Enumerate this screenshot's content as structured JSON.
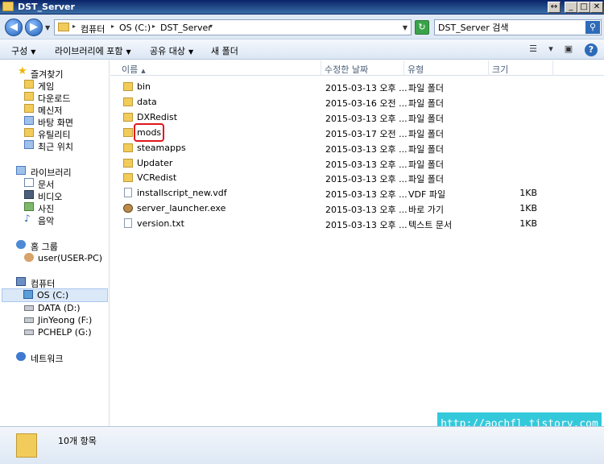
{
  "window": {
    "title": "DST_Server"
  },
  "title_buttons": [
    "↔",
    "_",
    "□",
    "✕"
  ],
  "address": {
    "crumbs": [
      "컴퓨터",
      "OS (C:)",
      "DST_Server"
    ]
  },
  "search": {
    "value": "DST_Server 검색"
  },
  "toolbar": {
    "organize": "구성",
    "include_library": "라이브러리에 포함",
    "share": "공유 대상",
    "new_folder": "새 폴더"
  },
  "nav": {
    "favorites": {
      "label": "즐겨찾기",
      "items": [
        "게임",
        "다운로드",
        "메신저",
        "바탕 화면",
        "유틸리티",
        "최근 위치"
      ]
    },
    "libraries": {
      "label": "라이브러리",
      "items": [
        "문서",
        "비디오",
        "사진",
        "음악"
      ]
    },
    "homegroup": {
      "label": "홈 그룹",
      "items": [
        "user(USER-PC)"
      ]
    },
    "computer": {
      "label": "컴퓨터",
      "items": [
        "OS (C:)",
        "DATA (D:)",
        "JinYeong (F:)",
        "PCHELP (G:)"
      ],
      "selected": "OS (C:)"
    },
    "network": {
      "label": "네트워크"
    }
  },
  "columns": {
    "name": "이름",
    "date": "수정한 날짜",
    "type": "유형",
    "size": "크기"
  },
  "files": [
    {
      "name": "bin",
      "date": "2015-03-13 오후 ...",
      "type": "파일 폴더",
      "size": "",
      "icon": "folder-icon"
    },
    {
      "name": "data",
      "date": "2015-03-16 오전 ...",
      "type": "파일 폴더",
      "size": "",
      "icon": "folder-icon"
    },
    {
      "name": "DXRedist",
      "date": "2015-03-13 오후 ...",
      "type": "파일 폴더",
      "size": "",
      "icon": "folder-icon"
    },
    {
      "name": "mods",
      "date": "2015-03-17 오전 ...",
      "type": "파일 폴더",
      "size": "",
      "icon": "folder-icon"
    },
    {
      "name": "steamapps",
      "date": "2015-03-13 오후 ...",
      "type": "파일 폴더",
      "size": "",
      "icon": "folder-icon"
    },
    {
      "name": "Updater",
      "date": "2015-03-13 오후 ...",
      "type": "파일 폴더",
      "size": "",
      "icon": "folder-icon"
    },
    {
      "name": "VCRedist",
      "date": "2015-03-13 오후 ...",
      "type": "파일 폴더",
      "size": "",
      "icon": "folder-icon"
    },
    {
      "name": "installscript_new.vdf",
      "date": "2015-03-13 오후 ...",
      "type": "VDF 파일",
      "size": "1KB",
      "icon": "file-icon"
    },
    {
      "name": "server_launcher.exe",
      "date": "2015-03-13 오후 ...",
      "type": "바로 가기",
      "size": "1KB",
      "icon": "exe-icon"
    },
    {
      "name": "version.txt",
      "date": "2015-03-13 오후 ...",
      "type": "텍스트 문서",
      "size": "1KB",
      "icon": "file-icon"
    }
  ],
  "status": {
    "count": "10개 항목"
  },
  "watermark": "http://aochfl.tistory.com",
  "colors": {
    "highlight": "#e0161c",
    "watermark_bg": "#1ec4d8"
  }
}
